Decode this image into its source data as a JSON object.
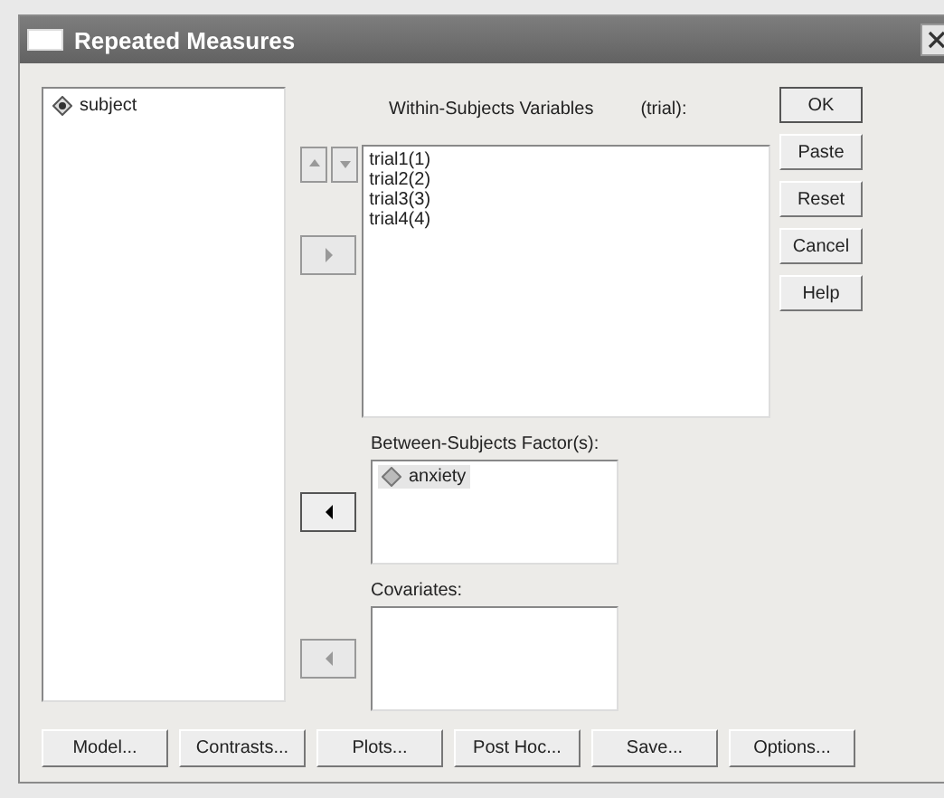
{
  "window": {
    "title": "Repeated Measures"
  },
  "source_list": {
    "items": [
      "subject"
    ]
  },
  "within": {
    "label": "Within-Subjects Variables",
    "factor": "(trial):",
    "items": [
      "trial1(1)",
      "trial2(2)",
      "trial3(3)",
      "trial4(4)"
    ],
    "order_buttons": [
      {
        "kind": "up",
        "disabled": true
      },
      {
        "kind": "down",
        "disabled": true
      }
    ],
    "move_button": {
      "kind": "right",
      "disabled": true
    }
  },
  "between": {
    "label": "Between-Subjects Factor(s):",
    "items": [
      {
        "label": "anxiety",
        "selected": true
      }
    ],
    "move_button": {
      "kind": "left",
      "disabled": false
    }
  },
  "covariates": {
    "label": "Covariates:",
    "move_button": {
      "kind": "left",
      "disabled": true
    }
  },
  "side_buttons": [
    {
      "label": "OK",
      "default": true
    },
    {
      "label": "Paste",
      "default": false
    },
    {
      "label": "Reset",
      "default": false
    },
    {
      "label": "Cancel",
      "default": false
    },
    {
      "label": "Help",
      "default": false
    }
  ],
  "bottom_buttons": [
    "Model...",
    "Contrasts...",
    "Plots...",
    "Post Hoc...",
    "Save...",
    "Options..."
  ]
}
